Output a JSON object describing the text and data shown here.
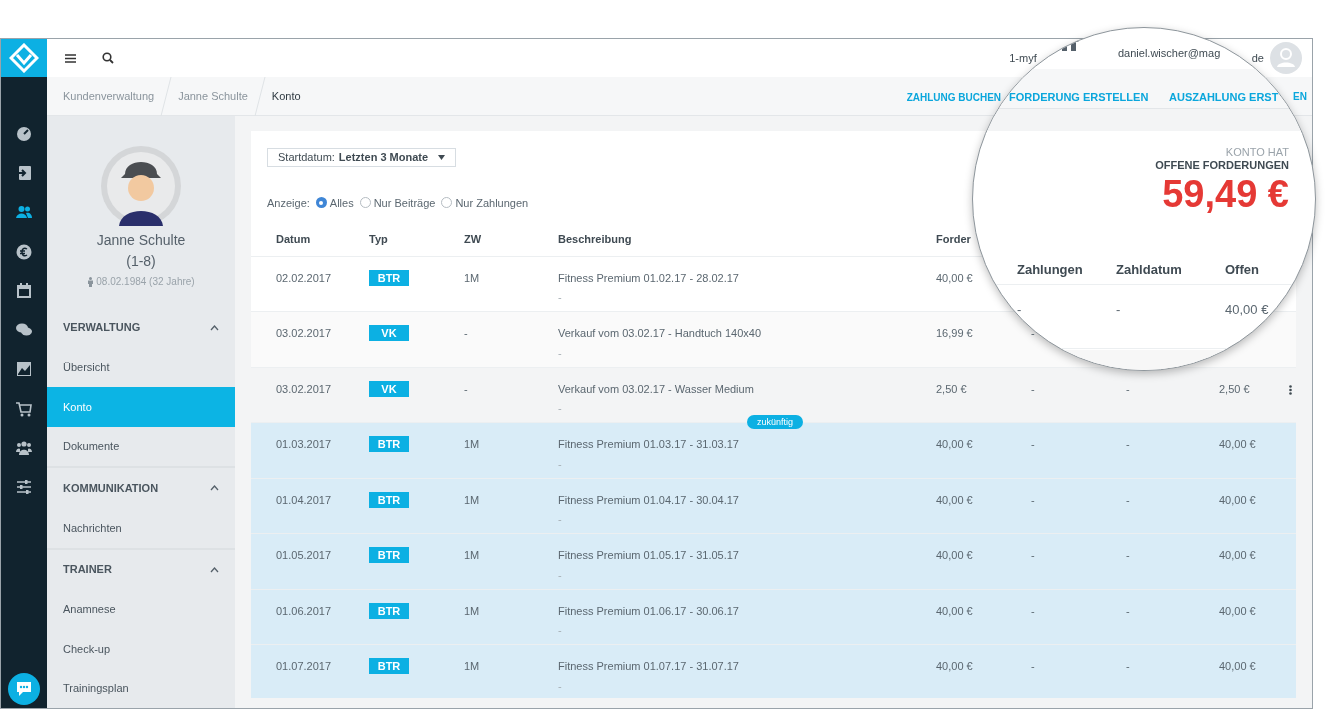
{
  "top_bar": {
    "account_fragment": "1-myf",
    "email_fragment": "de"
  },
  "rail": [
    {
      "selected": false
    },
    {
      "selected": false
    },
    {
      "selected": true
    },
    {
      "selected": false
    },
    {
      "selected": false
    },
    {
      "selected": false
    },
    {
      "selected": false
    },
    {
      "selected": false
    },
    {
      "selected": false
    },
    {
      "selected": false
    }
  ],
  "breadcrumbs": [
    {
      "label": "Kundenverwaltung",
      "selected": false
    },
    {
      "label": "Janne Schulte",
      "selected": false
    },
    {
      "label": "Konto",
      "selected": true
    }
  ],
  "actions": [
    "ZAHLUNG BUCHEN"
  ],
  "actions_fragment": "EN",
  "profile": {
    "name": "Janne Schulte",
    "group": "(1-8)",
    "birth": "08.02.1984 (32 Jahre)"
  },
  "sections": [
    {
      "title": "VERWALTUNG",
      "expanded": true,
      "items": [
        {
          "label": "Übersicht",
          "selected": false
        },
        {
          "label": "Konto",
          "selected": true
        },
        {
          "label": "Dokumente",
          "selected": false
        }
      ]
    },
    {
      "title": "KOMMUNIKATION",
      "expanded": true,
      "items": [
        {
          "label": "Nachrichten",
          "selected": false
        }
      ]
    },
    {
      "title": "TRAINER",
      "expanded": true,
      "items": [
        {
          "label": "Anamnese",
          "selected": false
        },
        {
          "label": "Check-up",
          "selected": false
        },
        {
          "label": "Trainingsplan",
          "selected": false
        }
      ]
    }
  ],
  "filter": {
    "label": "Startdatum:",
    "value": "Letzten 3 Monate"
  },
  "display": {
    "label": "Anzeige:",
    "options": [
      {
        "label": "Alles",
        "selected": true
      },
      {
        "label": "Nur Beiträge",
        "selected": false
      },
      {
        "label": "Nur Zahlungen",
        "selected": false
      }
    ]
  },
  "table": {
    "columns": [
      "Datum",
      "Typ",
      "ZW",
      "Beschreibung",
      "Forder"
    ],
    "rows": [
      {
        "date": "02.02.2017",
        "type": "BTR",
        "zw": "1M",
        "description": "Fitness Premium 01.02.17 - 28.02.17",
        "note": "-",
        "claim": "40,00 €",
        "kind": "plain"
      },
      {
        "date": "03.02.2017",
        "type": "VK",
        "zw": "-",
        "description": "Verkauf vom 03.02.17 - Handtuch 140x40",
        "note": "-",
        "claim": "16,99 €",
        "payments": "-",
        "kind": "striped"
      },
      {
        "date": "03.02.2017",
        "type": "VK",
        "zw": "-",
        "description": "Verkauf vom 03.02.17 - Wasser Medium",
        "note": "-",
        "claim": "2,50 €",
        "payments": "-",
        "pay_date": "-",
        "open": "2,50 €",
        "kind": "hover",
        "menu": true
      },
      {
        "date": "01.03.2017",
        "type": "BTR",
        "zw": "1M",
        "description": "Fitness Premium 01.03.17 - 31.03.17",
        "note": "-",
        "claim": "40,00 €",
        "payments": "-",
        "pay_date": "-",
        "open": "40,00 €",
        "kind": "future",
        "badge": "zukünftig"
      },
      {
        "date": "01.04.2017",
        "type": "BTR",
        "zw": "1M",
        "description": "Fitness Premium 01.04.17 - 30.04.17",
        "note": "-",
        "claim": "40,00 €",
        "payments": "-",
        "pay_date": "-",
        "open": "40,00 €",
        "kind": "future"
      },
      {
        "date": "01.05.2017",
        "type": "BTR",
        "zw": "1M",
        "description": "Fitness Premium 01.05.17 - 31.05.17",
        "note": "-",
        "claim": "40,00 €",
        "payments": "-",
        "pay_date": "-",
        "open": "40,00 €",
        "kind": "future"
      },
      {
        "date": "01.06.2017",
        "type": "BTR",
        "zw": "1M",
        "description": "Fitness Premium 01.06.17 - 30.06.17",
        "note": "-",
        "claim": "40,00 €",
        "payments": "-",
        "pay_date": "-",
        "open": "40,00 €",
        "kind": "future"
      },
      {
        "date": "01.07.2017",
        "type": "BTR",
        "zw": "1M",
        "description": "Fitness Premium 01.07.17 - 31.07.17",
        "note": "-",
        "claim": "40,00 €",
        "payments": "-",
        "pay_date": "-",
        "open": "40,00 €",
        "kind": "future"
      }
    ]
  },
  "magnifier": {
    "email": "daniel.wischer@mag",
    "actions": [
      "FORDERUNG ERSTELLEN",
      "AUSZAHLUNG ERST"
    ],
    "caption": "KONTO HAT",
    "status": "OFFENE FORDERUNGEN",
    "amount": "59,49 €",
    "columns": [
      "Zahlungen",
      "Zahldatum",
      "Offen"
    ],
    "row": [
      "-",
      "-",
      "40,00 €"
    ]
  }
}
